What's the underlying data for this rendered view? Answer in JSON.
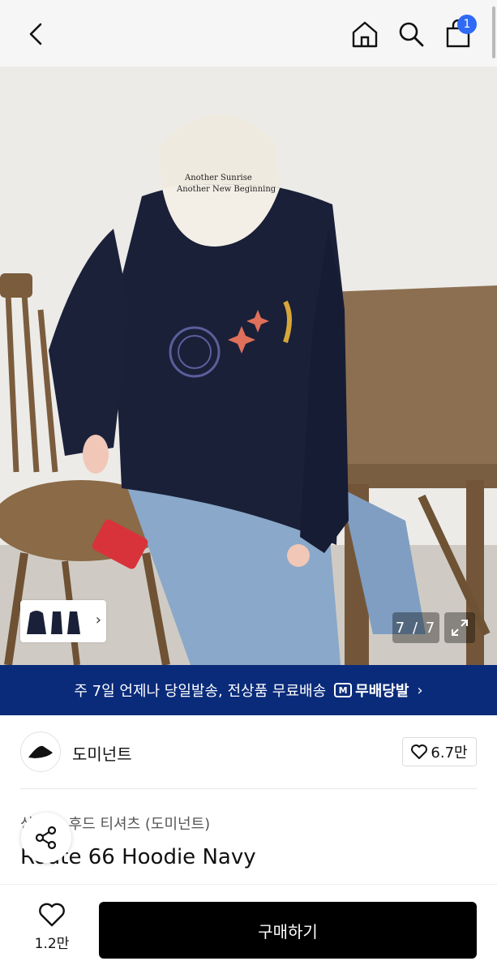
{
  "header": {
    "back_icon": "chevron-left-icon",
    "home_icon": "home-icon",
    "search_icon": "search-icon",
    "bag_icon": "shopping-bag-icon",
    "bag_badge": "1",
    "badge_color": "#2f6af5"
  },
  "gallery": {
    "cap_text_line1": "Another Sunrise",
    "cap_text_line2": "Another New Beginning",
    "counter": "7 / 7",
    "expand_icon": "expand-icon",
    "thumbnail_chevron": "›"
  },
  "banner": {
    "text": "주 7일 언제나 당일발송, 전상품 무료배송",
    "logo_mark": "M",
    "logo_text": "무배당발",
    "chevron": "›",
    "color": "#0a2b7a"
  },
  "brand": {
    "name": "도미넌트",
    "likes": "6.7만"
  },
  "product": {
    "category": "상의 > 후드 티셔츠 (도미넌트)",
    "title": "Route 66 Hoodie Navy"
  },
  "bottom": {
    "wish_count": "1.2만",
    "buy_label": "구매하기"
  }
}
